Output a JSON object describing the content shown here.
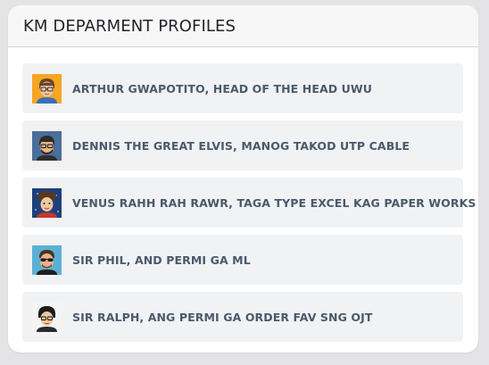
{
  "panel": {
    "title": "KM DEPARMENT PROFILES"
  },
  "profiles": [
    {
      "label": "ARTHUR GWAPOTITO, HEAD OF THE HEAD UWU",
      "avatar_bg": "#f5a623",
      "avatar_icon": "avatar-glasses-icon"
    },
    {
      "label": "DENNIS THE GREAT ELVIS, MANOG TAKOD UTP CABLE",
      "avatar_bg": "#4a6f9a",
      "avatar_icon": "avatar-bearded-icon"
    },
    {
      "label": "VENUS RAHH RAH RAWR, TAGA TYPE EXCEL KAG PAPER WORKS",
      "avatar_bg": "#1f3f7a",
      "avatar_icon": "avatar-curly-hair-icon"
    },
    {
      "label": "SIR PHIL, AND PERMI GA ML",
      "avatar_bg": "#5bb0d6",
      "avatar_icon": "avatar-sunglasses-icon"
    },
    {
      "label": "SIR RALPH, ANG PERMI GA ORDER FAV SNG OJT",
      "avatar_bg": "#f4f4f4",
      "avatar_icon": "avatar-dark-hair-icon"
    }
  ]
}
